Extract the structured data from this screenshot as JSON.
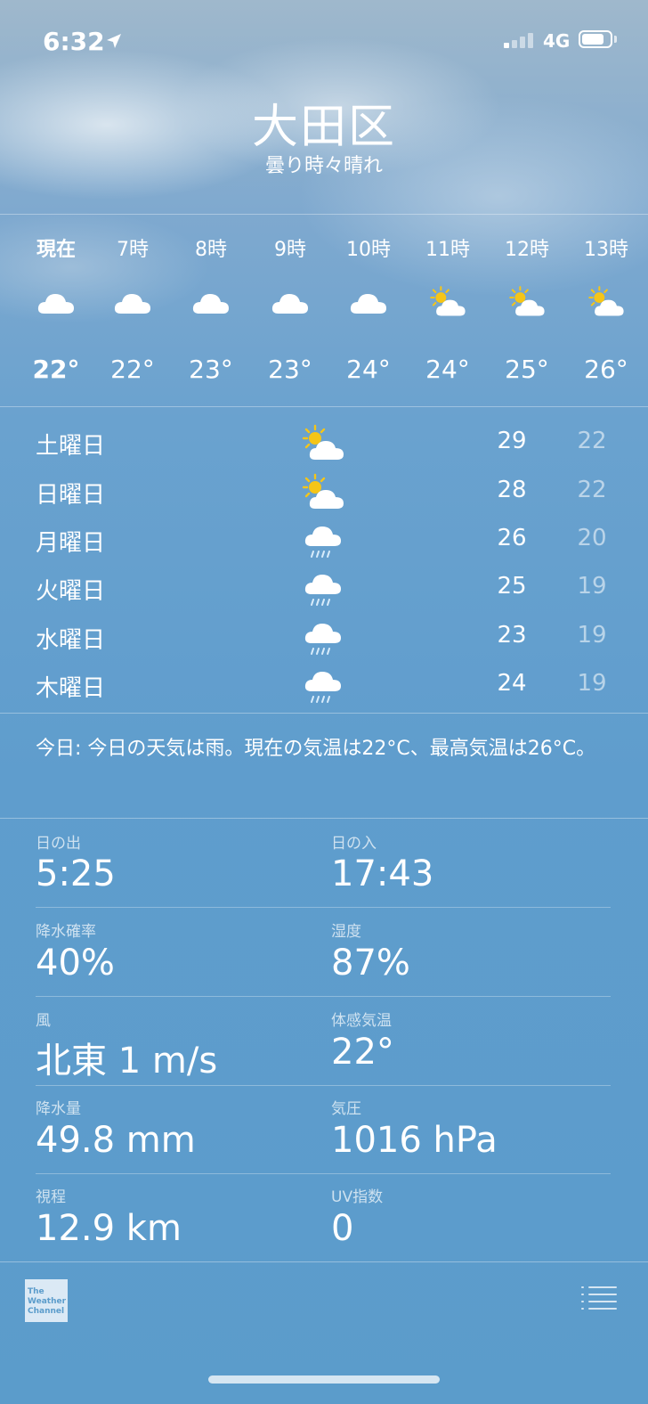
{
  "status_bar": {
    "time": "6:32",
    "network": "4G"
  },
  "header": {
    "city": "大田区",
    "condition": "曇り時々晴れ"
  },
  "hourly": [
    {
      "label": "現在",
      "temp": "22°",
      "icon": "cloud-icon",
      "bold": true
    },
    {
      "label": "7時",
      "temp": "22°",
      "icon": "cloud-icon"
    },
    {
      "label": "8時",
      "temp": "23°",
      "icon": "cloud-icon"
    },
    {
      "label": "9時",
      "temp": "23°",
      "icon": "cloud-icon"
    },
    {
      "label": "10時",
      "temp": "24°",
      "icon": "cloud-icon"
    },
    {
      "label": "11時",
      "temp": "24°",
      "icon": "partly-sunny-icon"
    },
    {
      "label": "12時",
      "temp": "25°",
      "icon": "partly-sunny-icon"
    },
    {
      "label": "13時",
      "temp": "26°",
      "icon": "partly-sunny-icon"
    }
  ],
  "daily": [
    {
      "day": "土曜日",
      "icon": "partly-sunny-icon",
      "high": "29",
      "low": "22"
    },
    {
      "day": "日曜日",
      "icon": "partly-sunny-icon",
      "high": "28",
      "low": "22"
    },
    {
      "day": "月曜日",
      "icon": "rain-icon",
      "high": "26",
      "low": "20"
    },
    {
      "day": "火曜日",
      "icon": "rain-icon",
      "high": "25",
      "low": "19"
    },
    {
      "day": "水曜日",
      "icon": "rain-icon",
      "high": "23",
      "low": "19"
    },
    {
      "day": "木曜日",
      "icon": "rain-icon",
      "high": "24",
      "low": "19"
    }
  ],
  "summary": "今日: 今日の天気は雨。現在の気温は22°C、最高気温は26°C。",
  "details": {
    "sunrise": {
      "label": "日の出",
      "value": "5:25"
    },
    "sunset": {
      "label": "日の入",
      "value": "17:43"
    },
    "precip_chance": {
      "label": "降水確率",
      "value": "40%"
    },
    "humidity": {
      "label": "湿度",
      "value": "87%"
    },
    "wind": {
      "label": "風",
      "value": "北東 1 m/s"
    },
    "feels_like": {
      "label": "体感気温",
      "value": "22°"
    },
    "precipitation": {
      "label": "降水量",
      "value": "49.8 mm"
    },
    "pressure": {
      "label": "気圧",
      "value": "1016 hPa"
    },
    "visibility": {
      "label": "視程",
      "value": "12.9 km"
    },
    "uv_index": {
      "label": "UV指数",
      "value": "0"
    }
  },
  "footer": {
    "logo_lines": [
      "The",
      "Weather",
      "Channel"
    ],
    "list_icon": "list-icon"
  },
  "colors": {
    "background": "#5b9ccb",
    "low_temp": "#b5d2ea",
    "sun": "#f5c518"
  }
}
